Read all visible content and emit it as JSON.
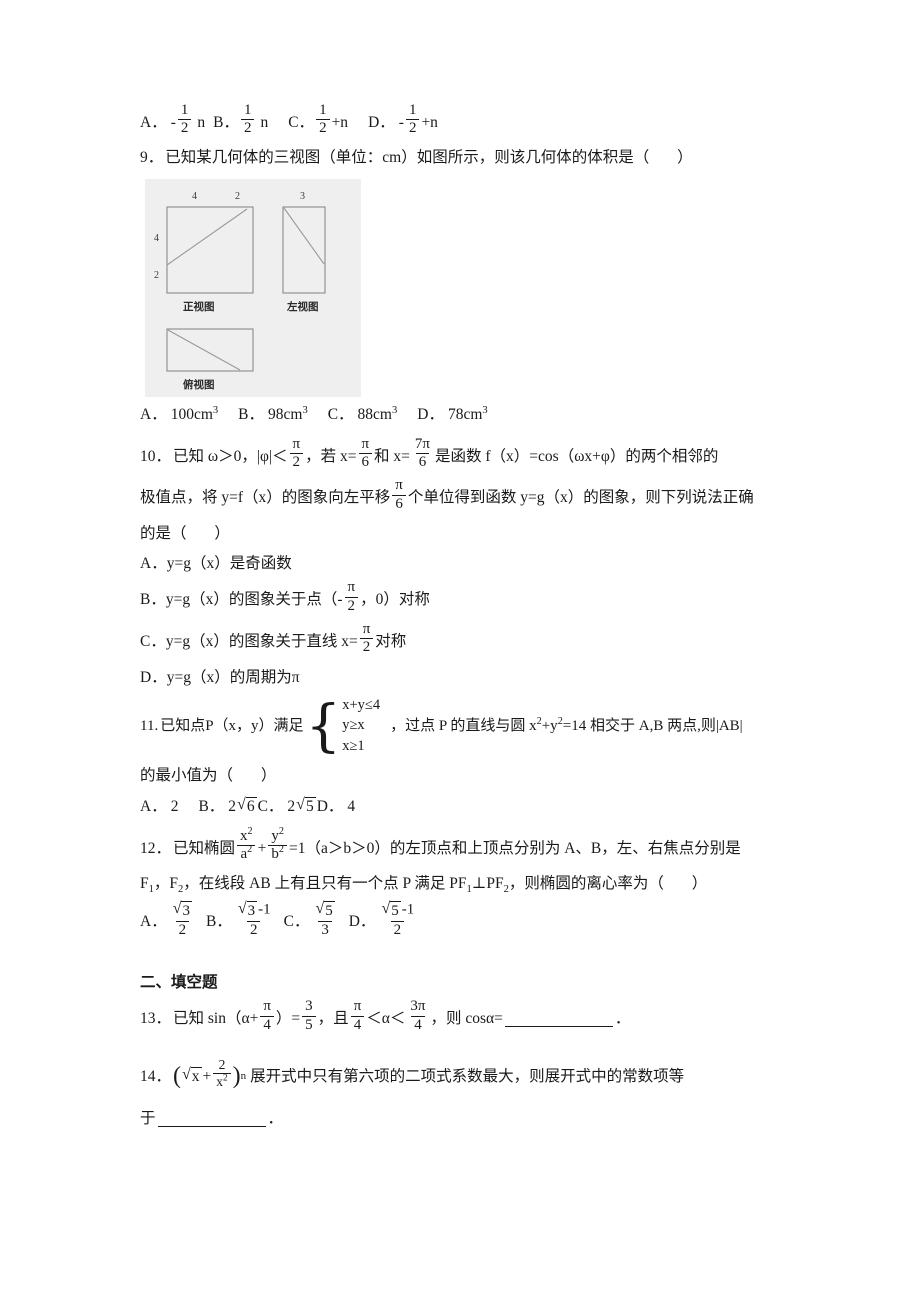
{
  "document": {
    "type": "math-exam-paper",
    "language": "zh-CN"
  },
  "q8_options": {
    "a_label": "A．",
    "a_sign": "-",
    "a_num": "1",
    "a_den": "2",
    "a_tail": "n",
    "b_label": "B．",
    "b_num": "1",
    "b_den": "2",
    "b_tail": "n",
    "c_label": "C．",
    "c_num": "1",
    "c_den": "2",
    "c_tail": "+n",
    "d_label": "D．",
    "d_sign": "-",
    "d_num": "1",
    "d_den": "2",
    "d_tail": "+n"
  },
  "q9": {
    "number": "9．",
    "stem": "已知某几何体的三视图（单位：cm）如图所示，则该几何体的体积是（",
    "stem_end": "）",
    "figure": {
      "name": "three-view-drawing",
      "front_view_label": "正视图",
      "side_view_label": "左视图",
      "top_view_label": "俯视图",
      "front_top_left": "4",
      "front_top_right": "2",
      "front_left_upper": "4",
      "front_left_lower": "2",
      "side_top": "3"
    },
    "options": [
      {
        "label": "A．",
        "value": "100cm",
        "exp": "3"
      },
      {
        "label": "B．",
        "value": "98cm",
        "exp": "3"
      },
      {
        "label": "C．",
        "value": "88cm",
        "exp": "3"
      },
      {
        "label": "D．",
        "value": "78cm",
        "exp": "3"
      }
    ]
  },
  "q10": {
    "number": "10．",
    "t1": "已知 ω＞0，",
    "abs_phi": "|φ|",
    "lt": "＜",
    "f1_num": "π",
    "f1_den": "2",
    "t2": "，若 x=",
    "f2_num": "π",
    "f2_den": "6",
    "t3": "和 x=",
    "f3_num": "7π",
    "f3_den": "6",
    "t4": "是函数 f（x）=cos（ωx+φ）的两个相邻的",
    "t5": "极值点，将 y=f（x）的图象向左平移",
    "f4_num": "π",
    "f4_den": "6",
    "t6": "个单位得到函数 y=g（x）的图象，则下列说法正确",
    "t7": "的是（",
    "t8": "）",
    "options": {
      "a_label": "A．",
      "a_text": "y=g（x）是奇函数",
      "b_label": "B．",
      "b_text1": "y=g（x）的图象关于点（-",
      "b_num": "π",
      "b_den": "2",
      "b_text2": "，0）对称",
      "c_label": "C．",
      "c_text1": "y=g（x）的图象关于直线 x=",
      "c_num": "π",
      "c_den": "2",
      "c_text2": "对称",
      "d_label": "D．",
      "d_text": "y=g（x）的周期为π"
    }
  },
  "q11": {
    "number": "11.",
    "t1": "已知点P（x，y）满足",
    "sys": [
      "x+y≤4",
      "y≥x",
      "x≥1"
    ],
    "t2": "，过点 P 的直线与圆 x",
    "sup1": "2",
    "t3": "+y",
    "sup2": "2",
    "t4": "=14 相交于 A,B 两点,则",
    "t5": "|AB|",
    "t6": "的最小值为（",
    "t7": "）",
    "options": {
      "a_label": "A．",
      "a_text": "2",
      "b_label": "B．",
      "b_coef": "2",
      "b_rad": "6",
      "c_label": "C．",
      "c_coef": "2",
      "c_rad": "5",
      "d_label": "D．",
      "d_text": "4"
    }
  },
  "q12": {
    "number": "12．",
    "t1": "已知椭圆",
    "f1_num": "x",
    "f1_num_exp": "2",
    "f1_den": "a",
    "f1_den_exp": "2",
    "plus": "+",
    "f2_num": "y",
    "f2_num_exp": "2",
    "f2_den": "b",
    "f2_den_exp": "2",
    "t2": "=1（a＞b＞0）的左顶点和上顶点分别为 A、B，左、右焦点分别是",
    "t3": "F",
    "sub1": "1",
    "t4": "，F",
    "sub2": "2",
    "t5": "，在线段 AB 上有且只有一个点 P 满足 PF",
    "sub3": "1",
    "t6": "⊥PF",
    "sub4": "2",
    "t7": "，则椭圆的离心率为（",
    "t8": "）",
    "options": {
      "a_label": "A．",
      "a_num_rad": "3",
      "a_den": "2",
      "b_label": "B．",
      "b_num_rad": "3",
      "b_num_tail": "-1",
      "b_den": "2",
      "c_label": "C．",
      "c_num_rad": "5",
      "c_den": "3",
      "d_label": "D．",
      "d_num_rad": "5",
      "d_num_tail": "-1",
      "d_den": "2"
    }
  },
  "section2": {
    "title": "二、填空题"
  },
  "q13": {
    "number": "13．",
    "t1": "已知 sin（α+",
    "f1_num": "π",
    "f1_den": "4",
    "t2": "）=",
    "f2_num": "3",
    "f2_den": "5",
    "t3": "，且",
    "f3_num": "π",
    "f3_den": "4",
    "lt1": "＜",
    "alpha": "α",
    "lt2": "＜",
    "f4_num": "3π",
    "f4_den": "4",
    "t4": "，则 cosα=",
    "t5": "．"
  },
  "q14": {
    "number": "14．",
    "open_paren": "(",
    "rad_body": "x",
    "plus": "+",
    "f_num": "2",
    "f_den": "x",
    "f_den_exp": "2",
    "close_paren": ")",
    "exp_n": "n",
    "t1": "展开式中只有第六项的二项式系数最大，则展开式中的常数项等",
    "t2": "于",
    "t3": "．"
  }
}
